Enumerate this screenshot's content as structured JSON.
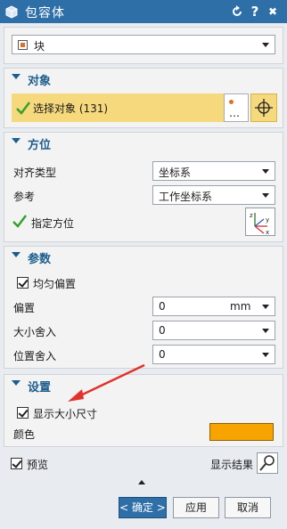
{
  "window": {
    "title": "包容体",
    "reset_icon": "reset-icon",
    "help_label": "?",
    "close_label": "✖"
  },
  "type_select": {
    "value": "块"
  },
  "sections": {
    "objects": {
      "title": "对象",
      "select_label": "选择对象 (131)"
    },
    "orientation": {
      "title": "方位",
      "align_type_label": "对齐类型",
      "align_type_value": "坐标系",
      "reference_label": "参考",
      "reference_value": "工作坐标系",
      "specify_label": "指定方位"
    },
    "parameters": {
      "title": "参数",
      "uniform_offset_label": "均匀偏置",
      "offset_label": "偏置",
      "offset_value": "0",
      "offset_unit": "mm",
      "size_round_label": "大小舍入",
      "size_round_value": "0",
      "position_round_label": "位置舍入",
      "position_round_value": "0"
    },
    "settings": {
      "title": "设置",
      "show_dims_label": "显示大小尺寸",
      "color_label": "颜色",
      "color_value": "#f7a400"
    }
  },
  "footer": {
    "preview_label": "预览",
    "show_result_label": "显示结果",
    "ok_label": "< 确定 >",
    "apply_label": "应用",
    "cancel_label": "取消"
  },
  "colors": {
    "titlebar": "#2f6fa8",
    "selection_highlight": "#f5d97c",
    "check_green": "#35a12f",
    "annotation_arrow": "#e0332b"
  }
}
